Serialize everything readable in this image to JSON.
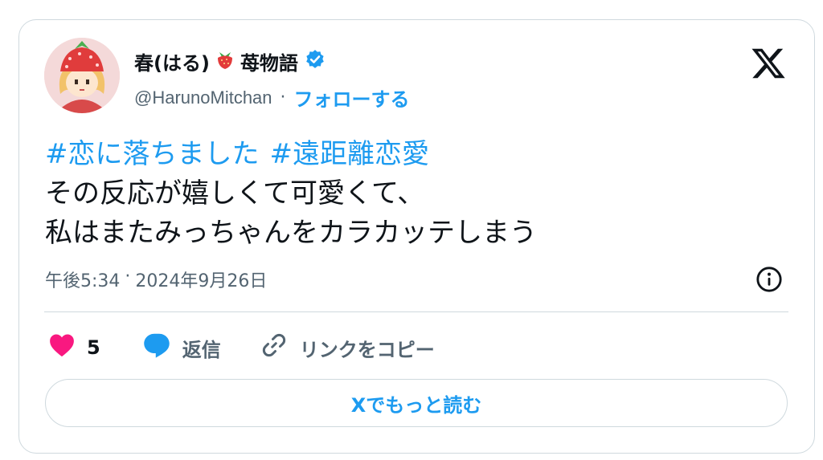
{
  "user": {
    "name": "春(はる)",
    "name_suffix": "苺物語",
    "handle": "@HarunoMitchan",
    "separator": "·",
    "follow_label": "フォローする",
    "verified": true
  },
  "tweet": {
    "hashtags": [
      "#恋に落ちました",
      "#遠距離恋愛"
    ],
    "lines": [
      "その反応が嬉しくて可愛くて、",
      "私はまたみっちゃんをカラカッテしまう"
    ],
    "time": "午後5:34",
    "date_separator": "·",
    "date": "2024年9月26日"
  },
  "actions": {
    "like_count": "5",
    "reply_label": "返信",
    "copy_link_label": "リンクをコピー"
  },
  "read_more_label": "Xでもっと読む",
  "colors": {
    "accent": "#1d9bf0",
    "like": "#f91880",
    "text": "#0f1419",
    "muted": "#536471",
    "border": "#cfd9de"
  },
  "icons": [
    "avatar",
    "strawberry-icon",
    "verified-badge-icon",
    "x-logo-icon",
    "info-icon",
    "heart-icon",
    "reply-bubble-icon",
    "link-icon"
  ]
}
